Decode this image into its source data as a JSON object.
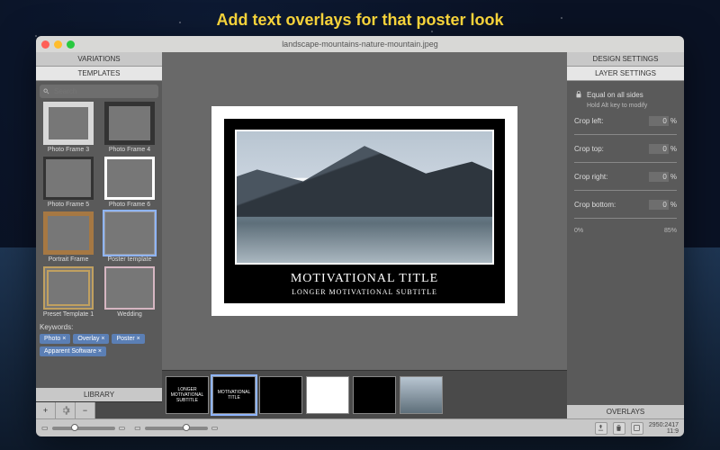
{
  "headline": "Add text overlays for that poster look",
  "window": {
    "title": "landscape-mountains-nature-mountain.jpeg"
  },
  "left_panel": {
    "tabs": [
      "VARIATIONS",
      "TEMPLATES"
    ],
    "active_tab": 1,
    "search_placeholder": "Search",
    "templates": [
      {
        "label": "Photo Frame 3"
      },
      {
        "label": "Photo Frame 4"
      },
      {
        "label": "Photo Frame 5"
      },
      {
        "label": "Photo Frame 6"
      },
      {
        "label": "Portrait Frame"
      },
      {
        "label": "Poster template"
      },
      {
        "label": "Preset Template 1"
      },
      {
        "label": "Wedding"
      }
    ],
    "keywords_label": "Keywords:",
    "chips": [
      "Photo ×",
      "Overlay ×",
      "Poster ×",
      "Apparent Software ×"
    ],
    "footer_label": "LIBRARY"
  },
  "canvas": {
    "poster_title": "MOTIVATIONAL TITLE",
    "poster_subtitle": "LONGER MOTIVATIONAL SUBTITLE"
  },
  "strip": {
    "items": [
      {
        "text": "LONGER MOTIVATIONAL SUBTITLE"
      },
      {
        "text": "MOTIVATIONAL TITLE"
      },
      {
        "text": ""
      },
      {
        "text": ""
      },
      {
        "text": ""
      },
      {
        "text": ""
      }
    ]
  },
  "right_panel": {
    "tabs": [
      "DESIGN SETTINGS",
      "LAYER SETTINGS"
    ],
    "active_tab": 1,
    "equal_label": "Equal on all sides",
    "equal_note": "Hold Alt key to modify",
    "crops": [
      {
        "label": "Crop left:",
        "value": "0",
        "unit": "%"
      },
      {
        "label": "Crop top:",
        "value": "0",
        "unit": "%"
      },
      {
        "label": "Crop right:",
        "value": "0",
        "unit": "%"
      },
      {
        "label": "Crop bottom:",
        "value": "0",
        "unit": "%"
      }
    ],
    "scale_min": "0%",
    "scale_max": "85%",
    "footer_label": "OVERLAYS"
  },
  "statusbar": {
    "zoom_value": "",
    "coords": "2950:2417",
    "ratio": "11:9"
  }
}
